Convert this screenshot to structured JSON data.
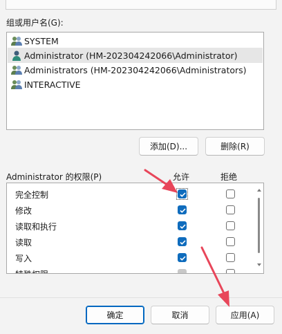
{
  "group_label": "组或用户名(G):",
  "users": [
    {
      "name": "SYSTEM",
      "selected": false,
      "icon": "users-group-icon"
    },
    {
      "name": "Administrator (HM-202304242066\\Administrator)",
      "selected": true,
      "icon": "user-icon"
    },
    {
      "name": "Administrators (HM-202304242066\\Administrators)",
      "selected": false,
      "icon": "users-group-icon"
    },
    {
      "name": "INTERACTIVE",
      "selected": false,
      "icon": "users-group-icon"
    }
  ],
  "buttons": {
    "add": "添加(D)...",
    "remove": "删除(R)",
    "ok": "确定",
    "cancel": "取消",
    "apply": "应用(A)"
  },
  "permissions": {
    "title": "Administrator 的权限(P)",
    "allow_header": "允许",
    "deny_header": "拒绝",
    "rows": [
      {
        "name": "完全控制",
        "allow": "checked",
        "deny": "unchecked"
      },
      {
        "name": "修改",
        "allow": "checked",
        "deny": "unchecked"
      },
      {
        "name": "读取和执行",
        "allow": "checked",
        "deny": "unchecked"
      },
      {
        "name": "读取",
        "allow": "checked",
        "deny": "unchecked"
      },
      {
        "name": "写入",
        "allow": "checked",
        "deny": "unchecked"
      },
      {
        "name": "特殊权限",
        "allow": "disabled",
        "deny": "unchecked"
      }
    ]
  },
  "colors": {
    "accent": "#0f6cbd",
    "annotation_arrow": "#e8465a"
  }
}
